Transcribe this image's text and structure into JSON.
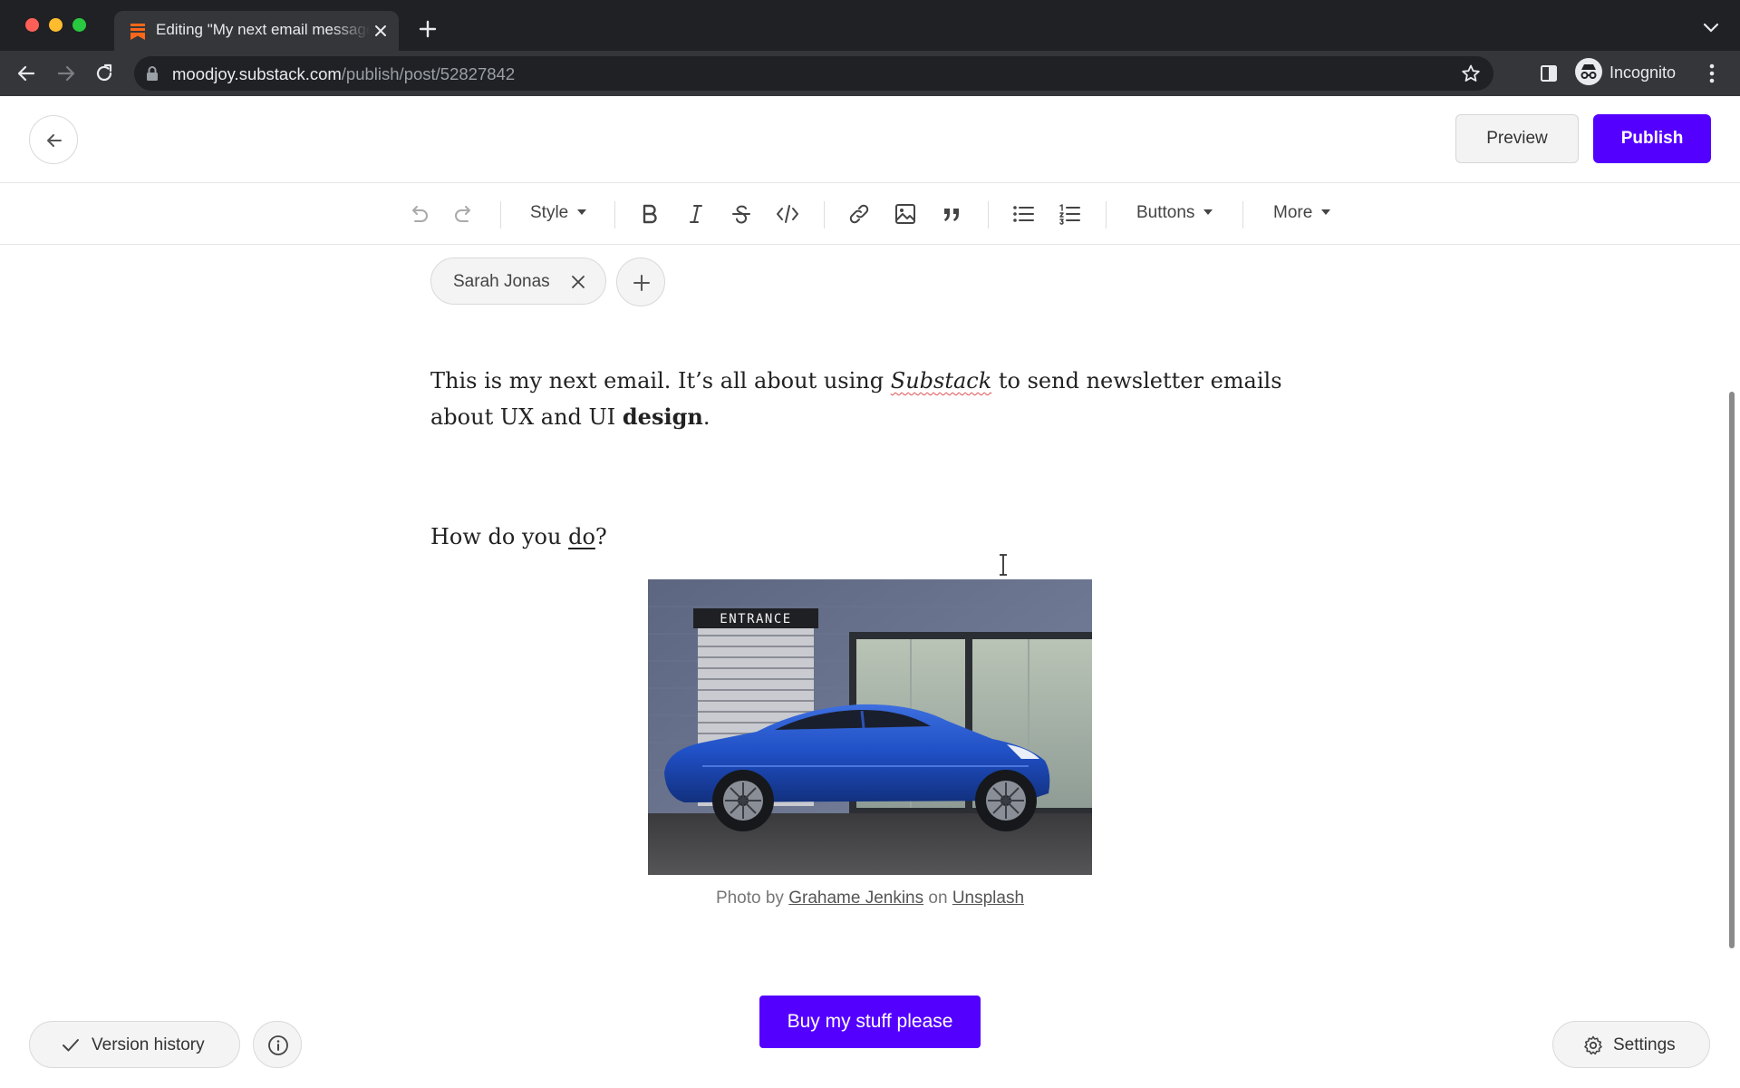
{
  "browser": {
    "tab_title": "Editing \"My next email message\"",
    "url_host": "moodjoy.substack.com",
    "url_path": "/publish/post/52827842",
    "profile_label": "Incognito"
  },
  "header": {
    "preview_label": "Preview",
    "publish_label": "Publish"
  },
  "toolbar": {
    "style_label": "Style",
    "buttons_label": "Buttons",
    "more_label": "More"
  },
  "post": {
    "author_chip": "Sarah Jonas",
    "para1": {
      "text_a": "This is my next email. It’s all about using ",
      "italic": "Substack",
      "text_b": " to send newsletter emails about UX and UI ",
      "bold": "design",
      "text_c": "."
    },
    "para2": {
      "text_a": "How do you ",
      "link": "do",
      "text_b": "?"
    },
    "image_sign": "ENTRANCE",
    "caption": {
      "prefix": "Photo by ",
      "author": "Grahame Jenkins",
      "middle": " on ",
      "source": "Unsplash"
    },
    "cta_label": "Buy my stuff please"
  },
  "footer": {
    "version_history_label": "Version history",
    "settings_label": "Settings"
  },
  "colors": {
    "brand_accent": "#5400ff",
    "substack_orange": "#ff6719"
  }
}
